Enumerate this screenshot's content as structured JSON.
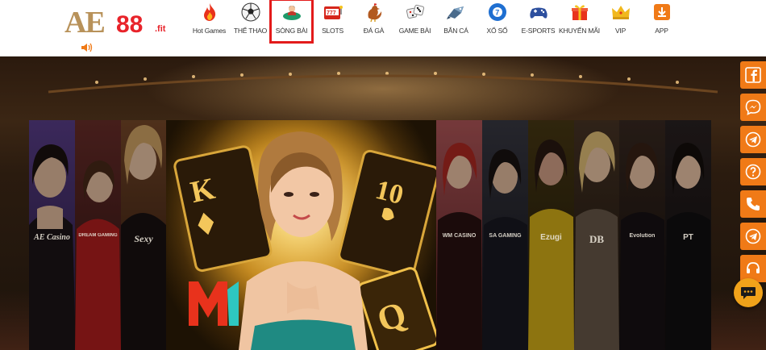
{
  "logo": {
    "ae": "AE",
    "num": "88",
    "suffix": ".fit"
  },
  "nav": {
    "items": [
      {
        "label": "Hot Games",
        "icon": "fire-icon"
      },
      {
        "label": "THỂ THAO",
        "icon": "soccer-ball-icon"
      },
      {
        "label": "SÒNG BÀI",
        "icon": "casino-dealer-icon",
        "active": true
      },
      {
        "label": "SLOTS",
        "icon": "slot-machine-icon"
      },
      {
        "label": "ĐÁ GÀ",
        "icon": "rooster-icon"
      },
      {
        "label": "GAME BÀI",
        "icon": "dice-icon"
      },
      {
        "label": "BẮN CÁ",
        "icon": "fish-icon"
      },
      {
        "label": "XỔ SỐ",
        "icon": "lottery-ball-icon"
      },
      {
        "label": "E-SPORTS",
        "icon": "gamepad-icon"
      },
      {
        "label": "KHUYẾN MÃI",
        "icon": "gift-icon"
      },
      {
        "label": "VIP",
        "icon": "crown-icon"
      },
      {
        "label": "APP",
        "icon": "download-icon"
      }
    ]
  },
  "banner": {
    "providers": [
      {
        "name": "AE Casino"
      },
      {
        "name": "DREAM GAMING"
      },
      {
        "name": "Sexy"
      },
      {
        "name": "M1"
      },
      {
        "name": "WM CASINO"
      },
      {
        "name": "SA GAMING"
      },
      {
        "name": "Ezugi"
      },
      {
        "name": "DB"
      },
      {
        "name": "Evolution"
      },
      {
        "name": "PT"
      }
    ]
  },
  "sidebar": {
    "buttons": [
      "facebook-icon",
      "messenger-icon",
      "telegram-icon",
      "help-icon",
      "phone-icon",
      "telegram-channel-icon",
      "support-headset-icon"
    ]
  },
  "colors": {
    "accent": "#f07a17",
    "active_outline": "#e31b1b",
    "logo_gold": "#b8925a",
    "logo_red": "#e8232a"
  }
}
